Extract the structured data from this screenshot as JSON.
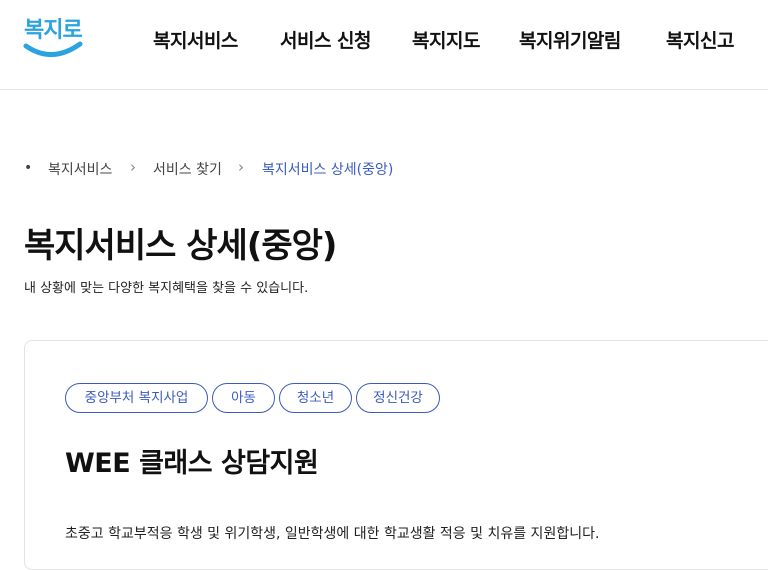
{
  "header": {
    "logo_text": "복지로",
    "nav": [
      {
        "label": "복지서비스"
      },
      {
        "label": "서비스 신청"
      },
      {
        "label": "복지지도"
      },
      {
        "label": "복지위기알림"
      },
      {
        "label": "복지신고"
      }
    ]
  },
  "breadcrumb": {
    "items": [
      {
        "label": "복지서비스"
      },
      {
        "label": "서비스 찾기"
      },
      {
        "label": "복지서비스 상세(중앙)"
      }
    ],
    "separator": "›"
  },
  "page": {
    "title": "복지서비스 상세(중앙)",
    "description": "내 상황에 맞는 다양한 복지혜택을 찾을 수 있습니다."
  },
  "service": {
    "tags": [
      {
        "label": "중앙부처 복지사업"
      },
      {
        "label": "아동"
      },
      {
        "label": "청소년"
      },
      {
        "label": "정신건강"
      }
    ],
    "title": "WEE 클래스 상담지원",
    "description": "초중고 학교부적응 학생 및 위기학생, 일반학생에 대한 학교생활 적응 및 치유를 지원합니다."
  },
  "colors": {
    "accent": "#3b5bbf",
    "logo": "#2aa3de"
  }
}
